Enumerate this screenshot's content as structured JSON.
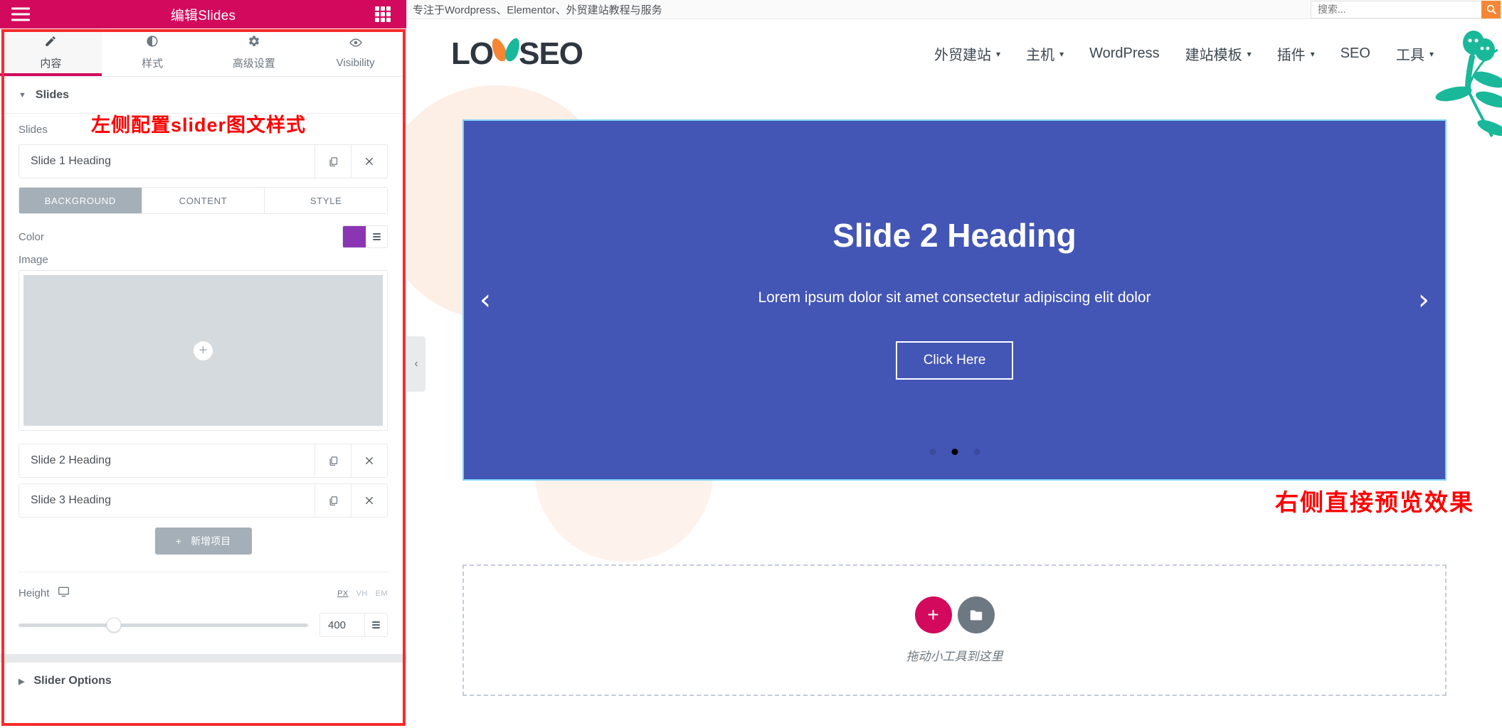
{
  "panel": {
    "title": "编辑Slides",
    "menu_icon": "hamburger-icon",
    "grid_icon": "grid-icon",
    "tabs": [
      {
        "label": "内容",
        "icon": "pencil-icon",
        "glyph": "✎",
        "active": true
      },
      {
        "label": "样式",
        "icon": "contrast-icon",
        "glyph": "◑",
        "active": false
      },
      {
        "label": "高级设置",
        "icon": "gear-icon",
        "glyph": "✿",
        "active": false
      },
      {
        "label": "Visibility",
        "icon": "eye-icon",
        "glyph": "◉",
        "active": false
      }
    ],
    "sections": {
      "slides": {
        "heading": "Slides",
        "caret": "▼",
        "field_label": "Slides",
        "items": [
          {
            "title": "Slide 1 Heading",
            "duplicate_icon": "duplicate-icon",
            "remove_icon": "close-icon",
            "open": true
          },
          {
            "title": "Slide 2 Heading",
            "duplicate_icon": "duplicate-icon",
            "remove_icon": "close-icon",
            "open": false
          },
          {
            "title": "Slide 3 Heading",
            "duplicate_icon": "duplicate-icon",
            "remove_icon": "close-icon",
            "open": false
          }
        ],
        "subtabs": [
          {
            "label": "BACKGROUND",
            "active": true
          },
          {
            "label": "CONTENT",
            "active": false
          },
          {
            "label": "STYLE",
            "active": false
          }
        ],
        "color": {
          "label": "Color",
          "value": "#8B35B5",
          "dynamic_icon": "database-icon"
        },
        "image": {
          "label": "Image",
          "add_icon": "plus-icon"
        },
        "add_item": {
          "label": "新增项目",
          "icon": "plus-icon"
        }
      },
      "height": {
        "label": "Height",
        "device_icon": "desktop-icon",
        "units": [
          {
            "label": "PX",
            "active": true
          },
          {
            "label": "VH",
            "active": false
          },
          {
            "label": "EM",
            "active": false
          }
        ],
        "value": "400",
        "dynamic_icon": "database-icon",
        "slider_percent": 33
      },
      "slider_options": {
        "heading": "Slider Options",
        "caret": "▶"
      }
    }
  },
  "annotations": {
    "left": "左侧配置slider图文样式",
    "right": "右侧直接预览效果",
    "color": "#FF0000"
  },
  "preview": {
    "topbar": {
      "tagline": "专注于Wordpress、Elementor、外贸建站教程与服务",
      "search_placeholder": "搜索...",
      "search_icon": "search-icon",
      "search_button_color": "#F58634"
    },
    "logo": {
      "text_before": "LO",
      "text_after": "SEO",
      "leaf_left_color": "#F58634",
      "leaf_right_color": "#19B89A"
    },
    "nav": [
      {
        "label": "外贸建站",
        "has_dropdown": true
      },
      {
        "label": "主机",
        "has_dropdown": true
      },
      {
        "label": "WordPress",
        "has_dropdown": false
      },
      {
        "label": "建站模板",
        "has_dropdown": true
      },
      {
        "label": "插件",
        "has_dropdown": true
      },
      {
        "label": "SEO",
        "has_dropdown": false
      },
      {
        "label": "工具",
        "has_dropdown": true
      }
    ],
    "slide": {
      "background": "#4355B5",
      "heading": "Slide 2 Heading",
      "paragraph": "Lorem ipsum dolor sit amet consectetur adipiscing elit dolor",
      "button": "Click Here",
      "prev_icon": "chevron-left-icon",
      "prev_glyph": "‹",
      "next_icon": "chevron-right-icon",
      "next_glyph": "›",
      "dots": [
        {
          "active": false
        },
        {
          "active": true
        },
        {
          "active": false
        }
      ]
    },
    "collapse_handle": {
      "icon": "chevron-left-icon",
      "glyph": "‹"
    },
    "dropzone": {
      "add_icon": "plus-icon",
      "add_glyph": "+",
      "folder_icon": "folder-icon",
      "folder_glyph": "▰",
      "text": "拖动小工具到这里",
      "add_color": "#D2095C",
      "folder_color": "#6D7882"
    }
  }
}
